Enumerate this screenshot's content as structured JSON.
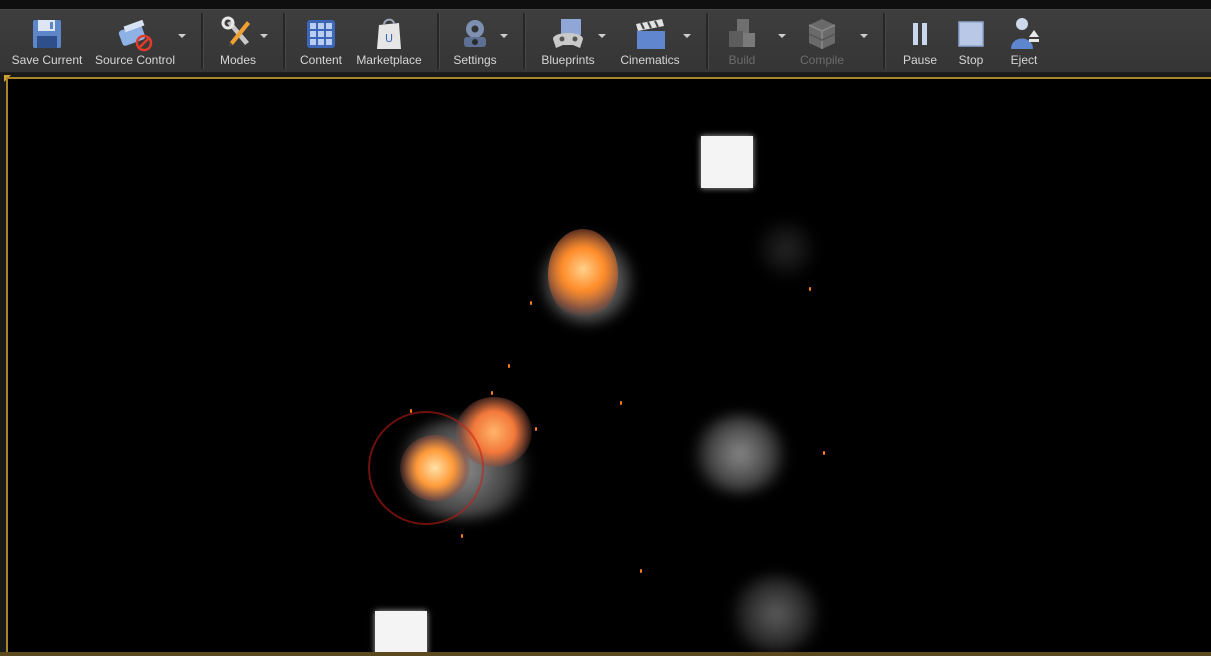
{
  "toolbar": {
    "save_current": "Save Current",
    "source_control": "Source Control",
    "modes": "Modes",
    "content": "Content",
    "marketplace": "Marketplace",
    "settings": "Settings",
    "blueprints": "Blueprints",
    "cinematics": "Cinematics",
    "build": "Build",
    "compile": "Compile",
    "pause": "Pause",
    "stop": "Stop",
    "eject": "Eject"
  },
  "icons": {
    "save_current": "floppy-disk-icon",
    "source_control": "source-control-disabled-icon",
    "modes": "tools-icon",
    "content": "content-grid-icon",
    "marketplace": "marketplace-bag-icon",
    "settings": "gears-icon",
    "blueprints": "gamepad-icon",
    "cinematics": "clapperboard-icon",
    "build": "blocks-icon",
    "compile": "cube-stack-icon",
    "pause": "pause-icon",
    "stop": "stop-square-icon",
    "eject": "eject-person-icon"
  },
  "colors": {
    "toolbar_bg": "#3a3a3a",
    "viewport_bg": "#000000",
    "viewport_border": "#a8872c",
    "label_text": "#d6d6d6",
    "label_disabled": "#6c6c6c",
    "explosion_core": "#ff8c2a",
    "smoke": "#8a8a8a"
  },
  "viewport": {
    "mode": "Play In Editor"
  }
}
